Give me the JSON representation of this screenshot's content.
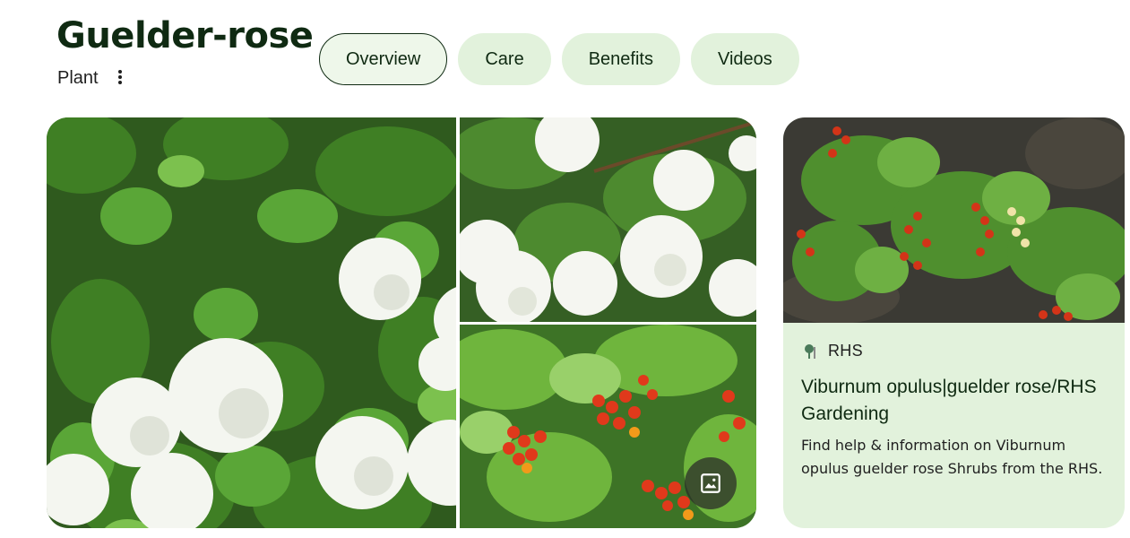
{
  "header": {
    "title": "Guelder-rose",
    "subtitle": "Plant"
  },
  "tabs": [
    {
      "label": "Overview",
      "active": true
    },
    {
      "label": "Care",
      "active": false
    },
    {
      "label": "Benefits",
      "active": false
    },
    {
      "label": "Videos",
      "active": false
    }
  ],
  "gallery": {
    "images": [
      "white-snowball-flowers",
      "white-flower-clusters-branch",
      "red-berry-clusters"
    ],
    "more_images_icon": "image-icon"
  },
  "result_card": {
    "source": "RHS",
    "source_icon": "tree-icon",
    "title": "Viburnum opulus|guelder rose/RHS Gardening",
    "description": "Find help & information on Viburnum opulus guelder rose Shrubs from the RHS."
  },
  "colors": {
    "tab_bg": "#e2f2dc",
    "tab_active_bg": "#eef7ea",
    "tab_active_border": "#0f2a12",
    "card_bg": "#e2f2dc",
    "title_text": "#0f2a12"
  }
}
